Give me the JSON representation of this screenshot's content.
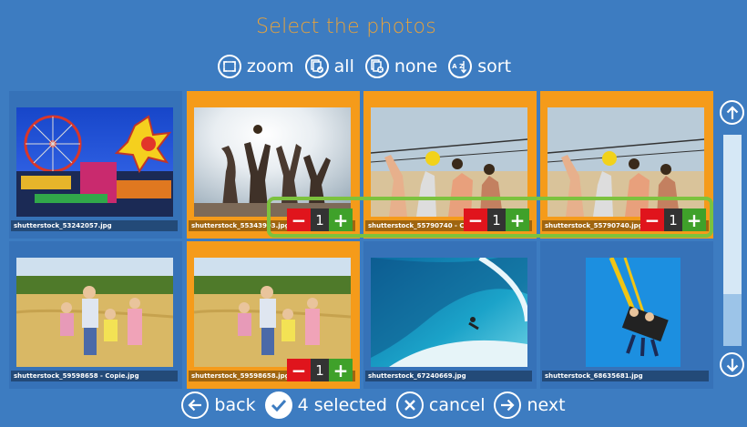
{
  "title": "Select the photos",
  "toolbar": {
    "zoom": "zoom",
    "all": "all",
    "none": "none",
    "sort": "sort",
    "sort_icon_text": "A Z"
  },
  "photos": [
    {
      "file": "shutterstock_53242057.jpg",
      "selected": false
    },
    {
      "file": "shutterstock_55343903.jpg",
      "selected": true,
      "qty": "1"
    },
    {
      "file": "shutterstock_55790740 - Copie.jpg",
      "selected": true,
      "qty": "1"
    },
    {
      "file": "shutterstock_55790740.jpg",
      "selected": true,
      "qty": "1"
    },
    {
      "file": "shutterstock_59598658 - Copie.jpg",
      "selected": false
    },
    {
      "file": "shutterstock_59598658.jpg",
      "selected": true,
      "qty": "1"
    },
    {
      "file": "shutterstock_67240669.jpg",
      "selected": false
    },
    {
      "file": "shutterstock_68635681.jpg",
      "selected": false
    }
  ],
  "qty_minus": "−",
  "qty_plus": "+",
  "bottom": {
    "back": "back",
    "selected": "4 selected",
    "cancel": "cancel",
    "next": "next"
  },
  "colors": {
    "background": "#3d7cc1",
    "selected_frame": "#f59b1a",
    "title": "#e8a23a",
    "minus": "#e0141c",
    "plus": "#3fa12a",
    "highlight": "#7cc23e"
  }
}
